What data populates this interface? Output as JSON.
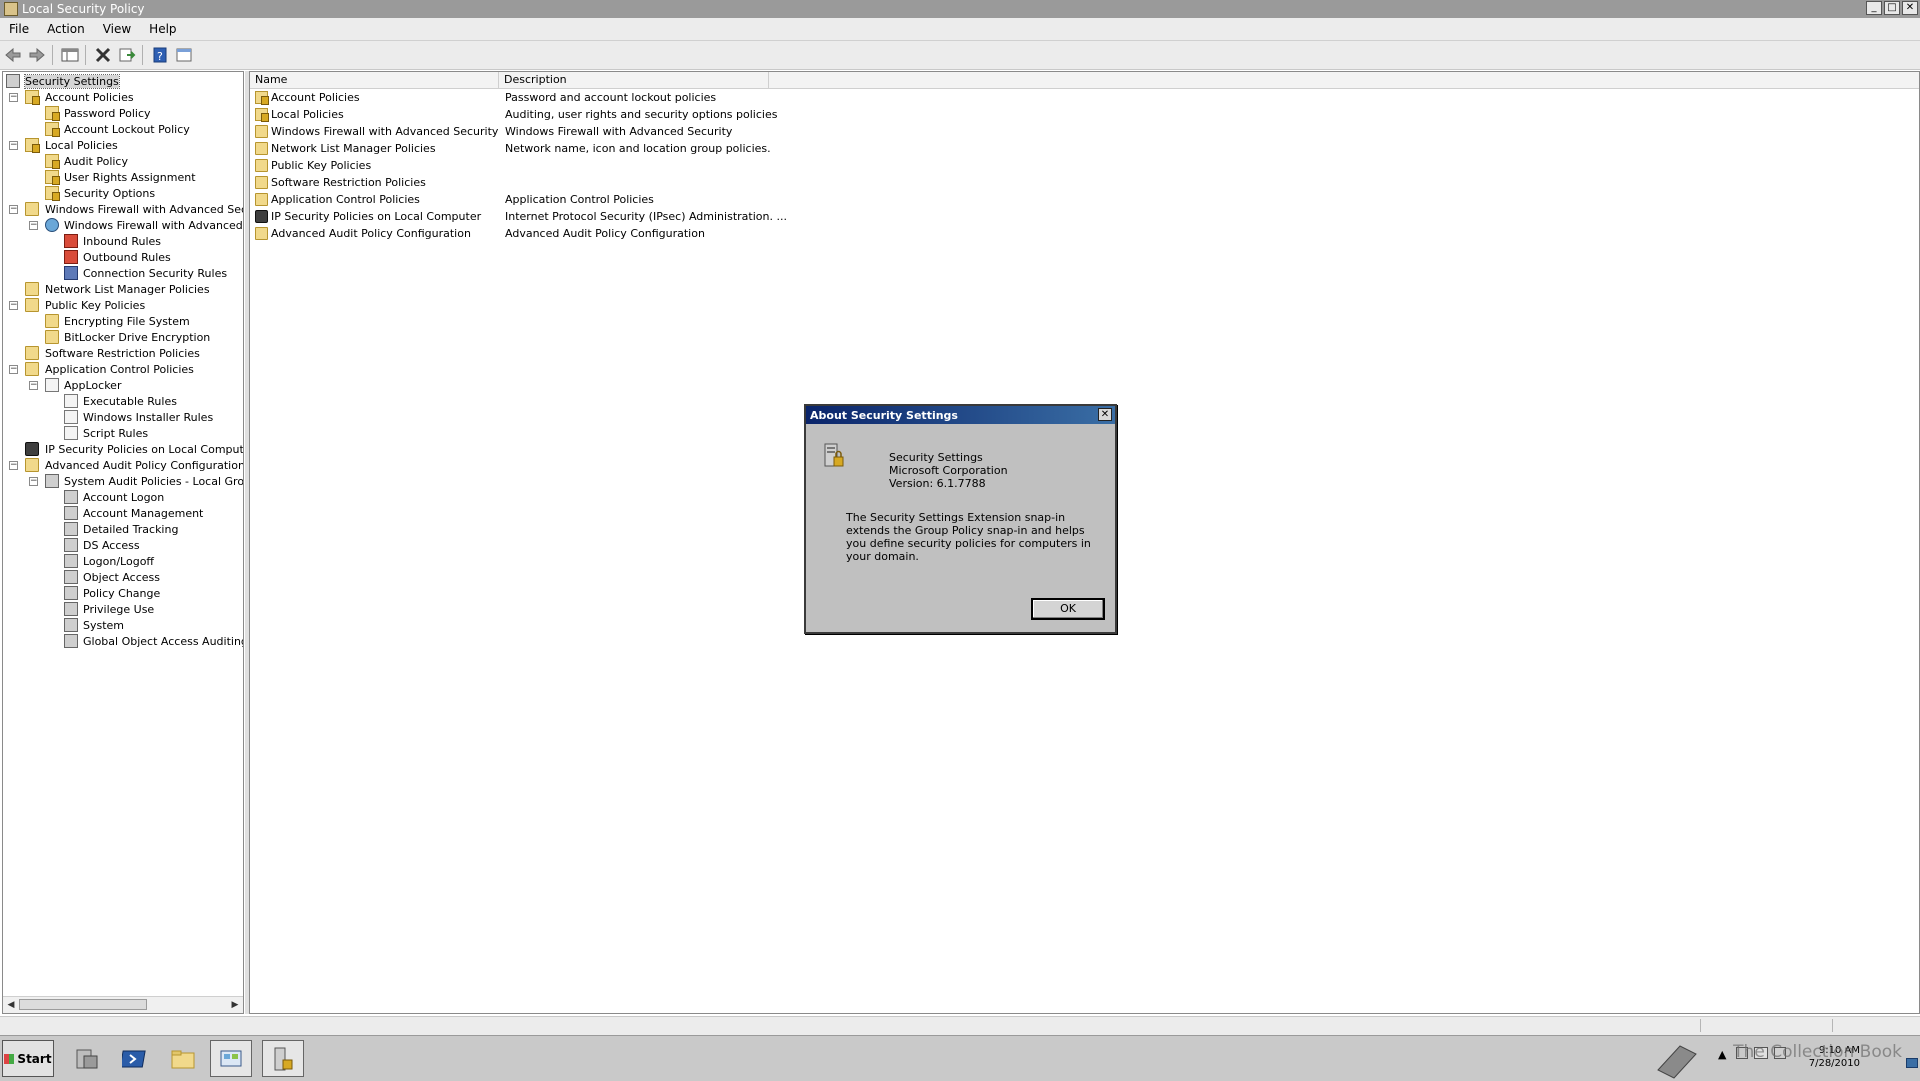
{
  "window": {
    "title": "Local Security Policy",
    "controls": {
      "minimize": "_",
      "maximize": "□",
      "close": "✕"
    }
  },
  "menubar": [
    "File",
    "Action",
    "View",
    "Help"
  ],
  "toolbar": [
    "back-icon",
    "forward-icon",
    "show-hide-tree-icon",
    "delete-icon",
    "export-list-icon",
    "help-icon",
    "properties-icon"
  ],
  "tree": {
    "root": "Security Settings",
    "items": [
      {
        "label": "Account Policies"
      },
      {
        "label": "Password Policy"
      },
      {
        "label": "Account Lockout Policy"
      },
      {
        "label": "Local Policies"
      },
      {
        "label": "Audit Policy"
      },
      {
        "label": "User Rights Assignment"
      },
      {
        "label": "Security Options"
      },
      {
        "label": "Windows Firewall with Advanced Security"
      },
      {
        "label": "Windows Firewall with Advanced Secu"
      },
      {
        "label": "Inbound Rules"
      },
      {
        "label": "Outbound Rules"
      },
      {
        "label": "Connection Security Rules"
      },
      {
        "label": "Network List Manager Policies"
      },
      {
        "label": "Public Key Policies"
      },
      {
        "label": "Encrypting File System"
      },
      {
        "label": "BitLocker Drive Encryption"
      },
      {
        "label": "Software Restriction Policies"
      },
      {
        "label": "Application Control Policies"
      },
      {
        "label": "AppLocker"
      },
      {
        "label": "Executable Rules"
      },
      {
        "label": "Windows Installer Rules"
      },
      {
        "label": "Script Rules"
      },
      {
        "label": "IP Security Policies on Local Computer"
      },
      {
        "label": "Advanced Audit Policy Configuration"
      },
      {
        "label": "System Audit Policies - Local Group Po"
      },
      {
        "label": "Account Logon"
      },
      {
        "label": "Account Management"
      },
      {
        "label": "Detailed Tracking"
      },
      {
        "label": "DS Access"
      },
      {
        "label": "Logon/Logoff"
      },
      {
        "label": "Object Access"
      },
      {
        "label": "Policy Change"
      },
      {
        "label": "Privilege Use"
      },
      {
        "label": "System"
      },
      {
        "label": "Global Object Access Auditing"
      }
    ]
  },
  "list": {
    "columns": [
      "Name",
      "Description"
    ],
    "rows": [
      {
        "name": "Account Policies",
        "description": "Password and account lockout policies"
      },
      {
        "name": "Local Policies",
        "description": "Auditing, user rights and security options policies"
      },
      {
        "name": "Windows Firewall with Advanced Security",
        "description": "Windows Firewall with Advanced Security"
      },
      {
        "name": "Network List Manager Policies",
        "description": "Network name, icon and location group policies."
      },
      {
        "name": "Public Key Policies",
        "description": ""
      },
      {
        "name": "Software Restriction Policies",
        "description": ""
      },
      {
        "name": "Application Control Policies",
        "description": "Application Control Policies"
      },
      {
        "name": "IP Security Policies on Local Computer",
        "description": "Internet Protocol Security (IPsec) Administration. ..."
      },
      {
        "name": "Advanced Audit Policy Configuration",
        "description": "Advanced Audit Policy Configuration"
      }
    ]
  },
  "dialog": {
    "title": "About Security Settings",
    "product": "Security Settings",
    "company": "Microsoft Corporation",
    "version": "Version: 6.1.7788",
    "description": "The Security Settings Extension snap-in extends the Group Policy snap-in and helps you define security policies for computers in your domain.",
    "ok_label": "OK",
    "close_label": "✕"
  },
  "taskbar": {
    "start_label": "Start",
    "clock_time": "9:10 AM",
    "clock_date": "7/28/2010",
    "watermark": "The Collection Book"
  }
}
